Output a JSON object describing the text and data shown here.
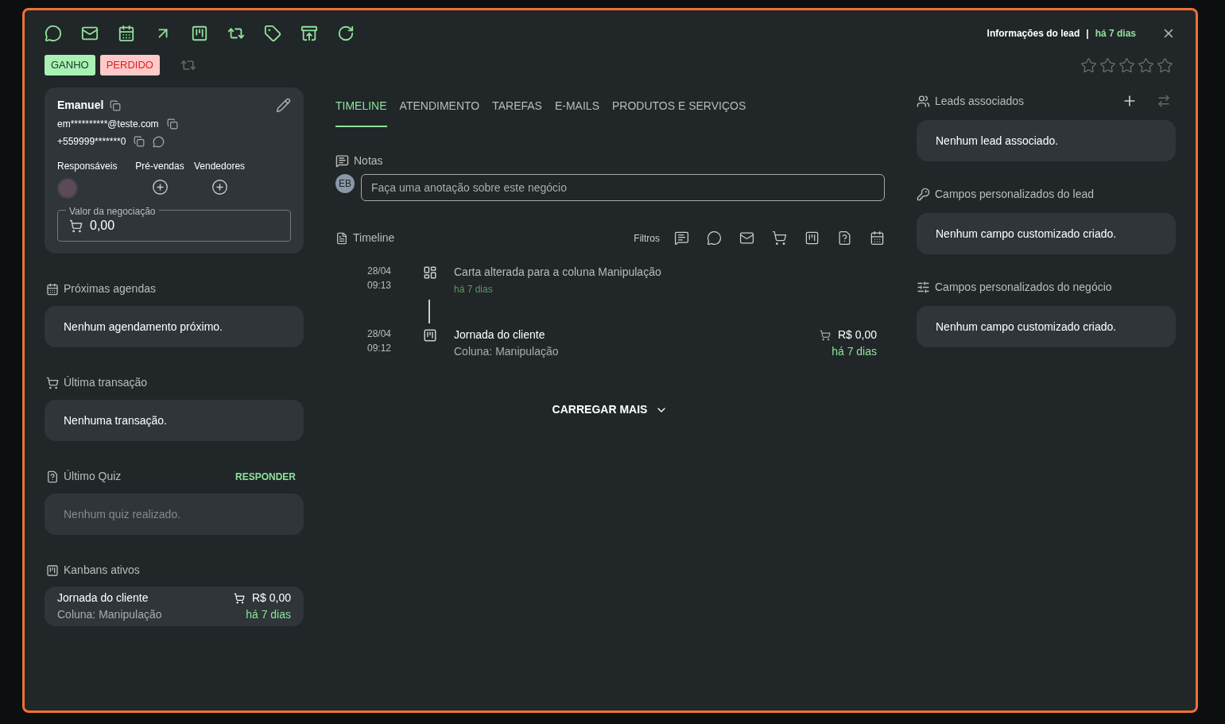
{
  "header": {
    "title": "Informações do lead",
    "separator": "|",
    "age": "há 7 dias",
    "stars": 0
  },
  "status_buttons": [
    {
      "label": "GANHO",
      "kind": "won"
    },
    {
      "label": "PERDIDO",
      "kind": "lost"
    }
  ],
  "contact": {
    "name": "Emanuel",
    "email": "em**********@teste.com",
    "phone": "+559999*******0",
    "roles": [
      "Responsáveis",
      "Pré-vendas",
      "Vendedores"
    ],
    "value_label": "Valor da negociação",
    "value": "0,00"
  },
  "left_sections": [
    {
      "kind": "calendar",
      "title": "Próximas agendas",
      "text": "Nenhum agendamento próximo.",
      "disabled": false
    },
    {
      "kind": "cart",
      "title": "Última transação",
      "text": "Nenhuma transação.",
      "disabled": false
    },
    {
      "kind": "quiz",
      "title": "Último Quiz",
      "action": "RESPONDER",
      "text": "Nenhum quiz realizado.",
      "disabled": true
    }
  ],
  "kanbans": {
    "title": "Kanbans ativos",
    "items": [
      {
        "name": "Jornada do cliente",
        "column": "Coluna: Manipulação",
        "value": "R$ 0,00",
        "age": "há 7 dias"
      }
    ]
  },
  "tabs": [
    {
      "label": "TIMELINE",
      "selected": true
    },
    {
      "label": "ATENDIMENTO",
      "selected": false
    },
    {
      "label": "TAREFAS",
      "selected": false
    },
    {
      "label": "E-MAILS",
      "selected": false
    },
    {
      "label": "PRODUTOS E SERVIÇOS",
      "selected": false
    }
  ],
  "notes": {
    "title": "Notas",
    "initials": "EB",
    "placeholder": "Faça uma anotação sobre este negócio"
  },
  "timeline": {
    "title": "Timeline",
    "filters_label": "Filtros",
    "items": [
      {
        "kind": "move",
        "date": "28/04",
        "time": "09:13",
        "title": "Carta alterada para a coluna Manipulação",
        "age": "há 7 dias"
      },
      {
        "kind": "kanban",
        "date": "28/04",
        "time": "09:12",
        "title": "Jornada do cliente",
        "subtitle": "Coluna: Manipulação",
        "value": "R$ 0,00",
        "age": "há 7 dias"
      }
    ],
    "load_more": "CARREGAR MAIS"
  },
  "right_sections": [
    {
      "kind": "leads",
      "title": "Leads associados",
      "text": "Nenhum lead associado."
    },
    {
      "kind": "key",
      "title": "Campos personalizados do lead",
      "text": "Nenhum campo customizado criado."
    },
    {
      "kind": "sliders",
      "title": "Campos personalizados do negócio",
      "text": "Nenhum campo customizado criado."
    }
  ]
}
